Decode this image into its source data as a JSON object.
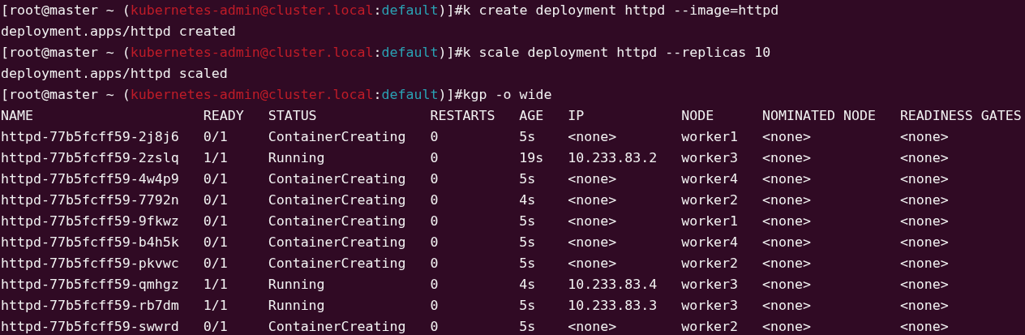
{
  "terminal": {
    "lines": [
      {
        "kind": "prompt",
        "prefix": "[root@master ~ (",
        "context": "kubernetes-admin@cluster.local",
        "separator": ":",
        "namespace": "default",
        "suffix": ")]#",
        "command": "k create deployment httpd --image=httpd"
      },
      {
        "kind": "output",
        "text": "deployment.apps/httpd created"
      },
      {
        "kind": "prompt",
        "prefix": "[root@master ~ (",
        "context": "kubernetes-admin@cluster.local",
        "separator": ":",
        "namespace": "default",
        "suffix": ")]#",
        "command": "k scale deployment httpd --replicas 10"
      },
      {
        "kind": "output",
        "text": "deployment.apps/httpd scaled"
      },
      {
        "kind": "prompt",
        "prefix": "[root@master ~ (",
        "context": "kubernetes-admin@cluster.local",
        "separator": ":",
        "namespace": "default",
        "suffix": ")]#",
        "command": "kgp -o wide"
      }
    ],
    "table": {
      "columns": [
        "NAME",
        "READY",
        "STATUS",
        "RESTARTS",
        "AGE",
        "IP",
        "NODE",
        "NOMINATED NODE",
        "READINESS GATES"
      ],
      "rows": [
        [
          "httpd-77b5fcff59-2j8j6",
          "0/1",
          "ContainerCreating",
          "0",
          "5s",
          "<none>",
          "worker1",
          "<none>",
          "<none>"
        ],
        [
          "httpd-77b5fcff59-2zslq",
          "1/1",
          "Running",
          "0",
          "19s",
          "10.233.83.2",
          "worker3",
          "<none>",
          "<none>"
        ],
        [
          "httpd-77b5fcff59-4w4p9",
          "0/1",
          "ContainerCreating",
          "0",
          "5s",
          "<none>",
          "worker4",
          "<none>",
          "<none>"
        ],
        [
          "httpd-77b5fcff59-7792n",
          "0/1",
          "ContainerCreating",
          "0",
          "4s",
          "<none>",
          "worker2",
          "<none>",
          "<none>"
        ],
        [
          "httpd-77b5fcff59-9fkwz",
          "0/1",
          "ContainerCreating",
          "0",
          "5s",
          "<none>",
          "worker1",
          "<none>",
          "<none>"
        ],
        [
          "httpd-77b5fcff59-b4h5k",
          "0/1",
          "ContainerCreating",
          "0",
          "5s",
          "<none>",
          "worker4",
          "<none>",
          "<none>"
        ],
        [
          "httpd-77b5fcff59-pkvwc",
          "0/1",
          "ContainerCreating",
          "0",
          "5s",
          "<none>",
          "worker2",
          "<none>",
          "<none>"
        ],
        [
          "httpd-77b5fcff59-qmhgz",
          "1/1",
          "Running",
          "0",
          "4s",
          "10.233.83.4",
          "worker3",
          "<none>",
          "<none>"
        ],
        [
          "httpd-77b5fcff59-rb7dm",
          "1/1",
          "Running",
          "0",
          "5s",
          "10.233.83.3",
          "worker3",
          "<none>",
          "<none>"
        ],
        [
          "httpd-77b5fcff59-swwrd",
          "0/1",
          "ContainerCreating",
          "0",
          "5s",
          "<none>",
          "worker2",
          "<none>",
          "<none>"
        ]
      ]
    }
  }
}
